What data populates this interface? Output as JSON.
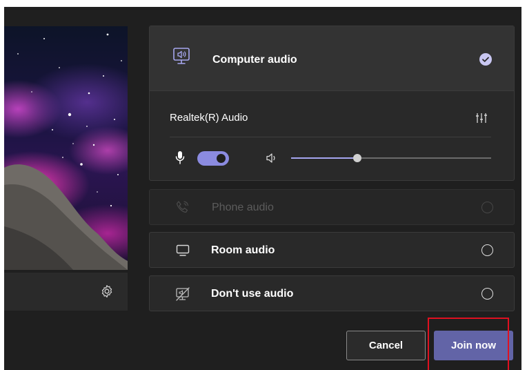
{
  "audio_options": {
    "computer": {
      "label": "Computer audio",
      "icon": "computer-audio-icon",
      "selected": true,
      "device": {
        "name": "Realtek(R) Audio",
        "settings_icon": "equalizer-icon",
        "microphone_on": true,
        "speaker_volume": 0.33
      }
    },
    "phone": {
      "label": "Phone audio",
      "icon": "phone-icon",
      "selected": false,
      "disabled": true
    },
    "room": {
      "label": "Room audio",
      "icon": "room-display-icon",
      "selected": false
    },
    "none": {
      "label": "Don't use audio",
      "icon": "no-audio-icon",
      "selected": false
    }
  },
  "video": {
    "settings_icon": "gear-icon"
  },
  "actions": {
    "cancel_label": "Cancel",
    "join_label": "Join now"
  },
  "colors": {
    "accent": "#6264a7",
    "toggle_on": "#8b8be0",
    "check": "#c9c7f2",
    "highlight": "#e01020"
  }
}
